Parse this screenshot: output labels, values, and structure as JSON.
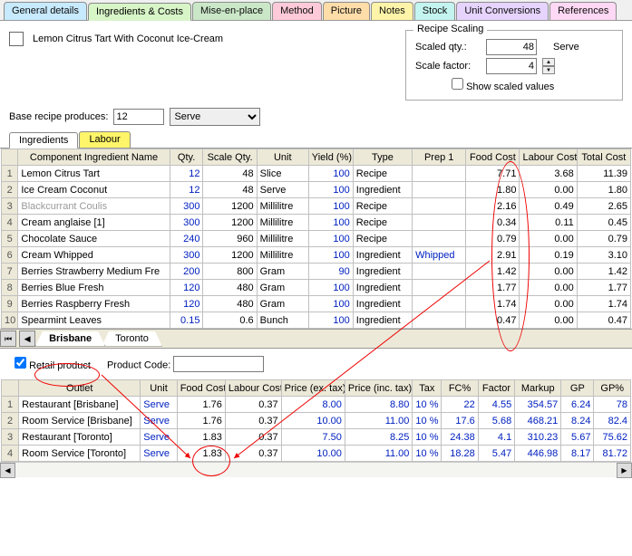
{
  "tabs": [
    "General details",
    "Ingredients & Costs",
    "Mise-en-place",
    "Method",
    "Picture",
    "Notes",
    "Stock",
    "Unit Conversions",
    "References"
  ],
  "tab_colors": [
    "#c5eaff",
    "#d8f5c8",
    "#c9e8c6",
    "#ffc8d9",
    "#ffdca6",
    "#fff5a6",
    "#c2f5ef",
    "#e6d3ff",
    "#ffd7f5"
  ],
  "active_tab": 1,
  "recipe_title": "Lemon Citrus Tart With Coconut Ice-Cream",
  "scaling": {
    "legend": "Recipe Scaling",
    "qty_label": "Scaled qty.:",
    "qty_value": "48",
    "qty_unit": "Serve",
    "factor_label": "Scale factor:",
    "factor_value": "4",
    "show_scaled_label": "Show scaled values",
    "show_scaled": false
  },
  "base": {
    "label": "Base recipe produces:",
    "qty": "12",
    "unit": "Serve"
  },
  "sub_tabs": [
    "Ingredients",
    "Labour"
  ],
  "active_sub_tab": 0,
  "ing_cols": [
    "Component Ingredient Name",
    "Qty.",
    "Scale Qty.",
    "Unit",
    "Yield (%)",
    "Type",
    "Prep 1",
    "Food Cost",
    "Labour Cost",
    "Total Cost"
  ],
  "ing_rows": [
    {
      "n": 1,
      "name": "Lemon Citrus Tart",
      "qty": "12",
      "sqty": "48",
      "unit": "Slice",
      "yield": "100",
      "type": "Recipe",
      "prep": "",
      "food": "7.71",
      "lab": "3.68",
      "tot": "11.39"
    },
    {
      "n": 2,
      "name": "Ice Cream Coconut",
      "qty": "12",
      "sqty": "48",
      "unit": "Serve",
      "yield": "100",
      "type": "Ingredient",
      "prep": "",
      "food": "1.80",
      "lab": "0.00",
      "tot": "1.80"
    },
    {
      "n": 3,
      "name": "Blackcurrant Coulis",
      "gray": true,
      "qty": "300",
      "sqty": "1200",
      "unit": "Millilitre",
      "yield": "100",
      "type": "Recipe",
      "prep": "",
      "food": "2.16",
      "lab": "0.49",
      "tot": "2.65"
    },
    {
      "n": 4,
      "name": "Cream anglaise [1]",
      "qty": "300",
      "sqty": "1200",
      "unit": "Millilitre",
      "yield": "100",
      "type": "Recipe",
      "prep": "",
      "food": "0.34",
      "lab": "0.11",
      "tot": "0.45"
    },
    {
      "n": 5,
      "name": "Chocolate Sauce",
      "qty": "240",
      "sqty": "960",
      "unit": "Millilitre",
      "yield": "100",
      "type": "Recipe",
      "prep": "",
      "food": "0.79",
      "lab": "0.00",
      "tot": "0.79"
    },
    {
      "n": 6,
      "name": "Cream Whipped",
      "qty": "300",
      "sqty": "1200",
      "unit": "Millilitre",
      "yield": "100",
      "type": "Ingredient",
      "prep": "Whipped",
      "prepblue": true,
      "food": "2.91",
      "lab": "0.19",
      "tot": "3.10"
    },
    {
      "n": 7,
      "name": "Berries Strawberry Medium Fre",
      "qty": "200",
      "sqty": "800",
      "unit": "Gram",
      "yield": "90",
      "type": "Ingredient",
      "prep": "",
      "food": "1.42",
      "lab": "0.00",
      "tot": "1.42"
    },
    {
      "n": 8,
      "name": "Berries Blue Fresh",
      "qty": "120",
      "sqty": "480",
      "unit": "Gram",
      "yield": "100",
      "type": "Ingredient",
      "prep": "",
      "food": "1.77",
      "lab": "0.00",
      "tot": "1.77"
    },
    {
      "n": 9,
      "name": "Berries Raspberry Fresh",
      "qty": "120",
      "sqty": "480",
      "unit": "Gram",
      "yield": "100",
      "type": "Ingredient",
      "prep": "",
      "food": "1.74",
      "lab": "0.00",
      "tot": "1.74"
    },
    {
      "n": 10,
      "name": "Spearmint Leaves",
      "qty": "0.15",
      "sqty": "0.6",
      "unit": "Bunch",
      "yield": "100",
      "type": "Ingredient",
      "prep": "",
      "food": "0.47",
      "lab": "0.00",
      "tot": "0.47"
    }
  ],
  "ws_tabs": [
    "Brisbane",
    "Toronto"
  ],
  "active_ws_tab": 0,
  "retail": {
    "checkbox_label": "Retail product",
    "checked": true,
    "code_label": "Product Code:",
    "code_value": ""
  },
  "outlet_cols": [
    "Outlet",
    "Unit",
    "Food Cost",
    "Labour Cost",
    "Price (ex. tax)",
    "Price (inc. tax)",
    "Tax",
    "FC%",
    "Factor",
    "Markup",
    "GP",
    "GP%"
  ],
  "outlet_rows": [
    {
      "n": 1,
      "outlet": "Restaurant [Brisbane]",
      "unit": "Serve",
      "food": "1.76",
      "lab": "0.37",
      "pex": "8.00",
      "pinc": "8.80",
      "tax": "10 %",
      "fc": "22",
      "factor": "4.55",
      "markup": "354.57",
      "gp": "6.24",
      "gpp": "78"
    },
    {
      "n": 2,
      "outlet": "Room Service [Brisbane]",
      "unit": "Serve",
      "food": "1.76",
      "lab": "0.37",
      "pex": "10.00",
      "pinc": "11.00",
      "tax": "10 %",
      "fc": "17.6",
      "factor": "5.68",
      "markup": "468.21",
      "gp": "8.24",
      "gpp": "82.4"
    },
    {
      "n": 3,
      "outlet": "Restaurant [Toronto]",
      "unit": "Serve",
      "food": "1.83",
      "lab": "0.37",
      "pex": "7.50",
      "pinc": "8.25",
      "tax": "10 %",
      "fc": "24.38",
      "factor": "4.1",
      "markup": "310.23",
      "gp": "5.67",
      "gpp": "75.62"
    },
    {
      "n": 4,
      "outlet": "Room Service [Toronto]",
      "unit": "Serve",
      "food": "1.83",
      "lab": "0.37",
      "pex": "10.00",
      "pinc": "11.00",
      "tax": "10 %",
      "fc": "18.28",
      "factor": "5.47",
      "markup": "446.98",
      "gp": "8.17",
      "gpp": "81.72"
    }
  ]
}
